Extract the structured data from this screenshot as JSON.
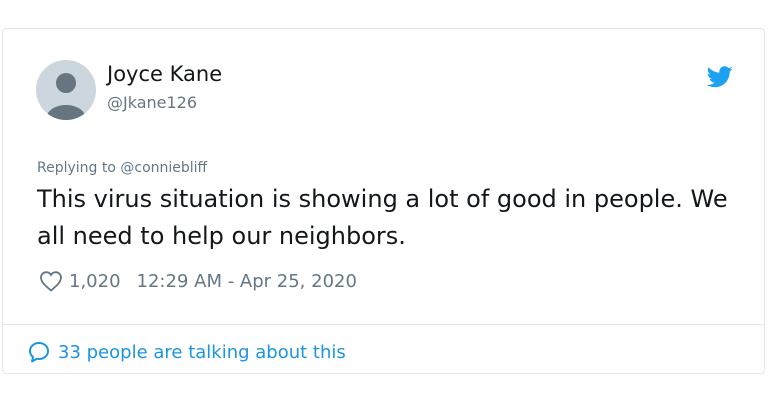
{
  "user": {
    "name": "Joyce Kane",
    "handle": "@Jkane126"
  },
  "tweet": {
    "replying_to": "Replying to @conniebliff",
    "text": "This virus situation is showing a lot of good in people. We all need to help our neighbors.",
    "likes": "1,020",
    "timestamp": "12:29 AM - Apr 25, 2020"
  },
  "footer": {
    "talking": "33 people are talking about this"
  },
  "icons": {
    "brand": "twitter-bird-icon",
    "like": "heart-outline-icon",
    "reply": "speech-bubble-icon"
  },
  "colors": {
    "brand_blue": "#1da1f2",
    "link_blue": "#1b95e0",
    "text": "#14171a",
    "muted": "#657786",
    "border": "#e1e8ed"
  }
}
